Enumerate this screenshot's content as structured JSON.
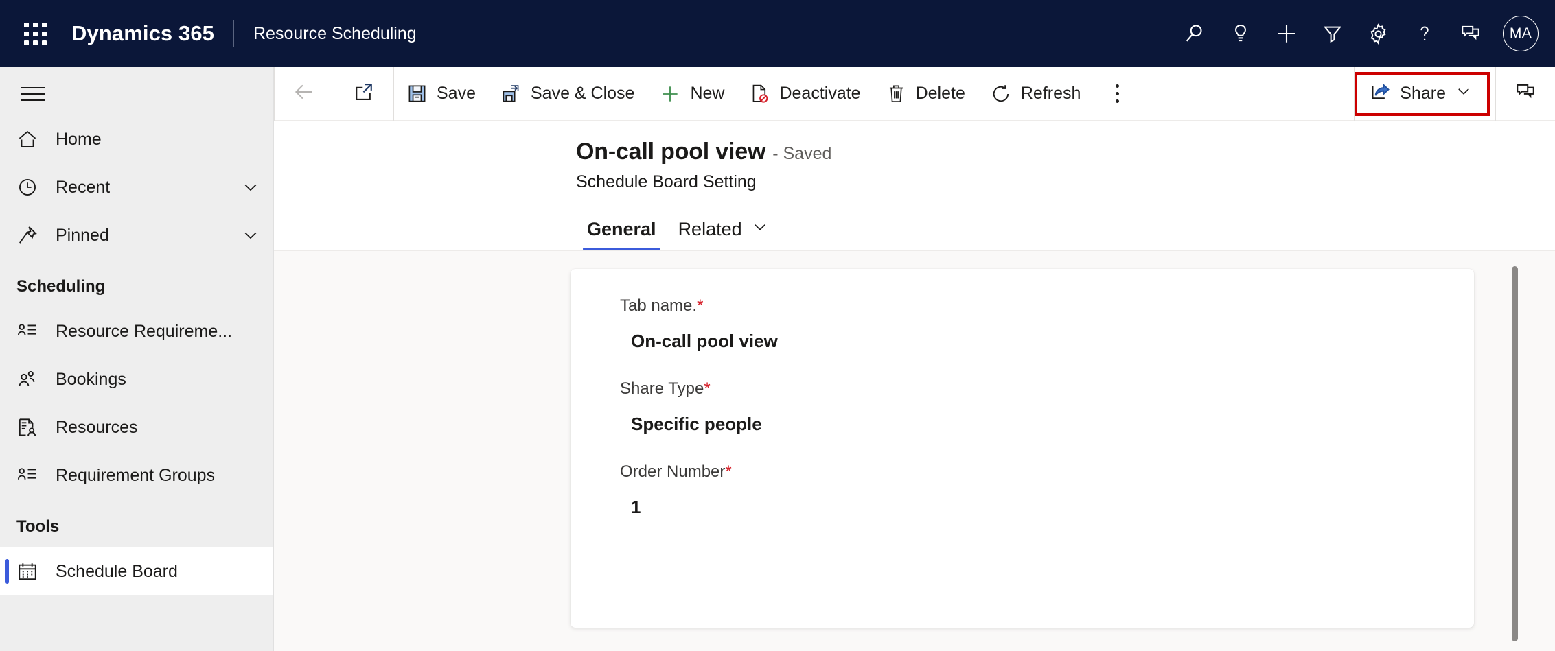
{
  "appbar": {
    "waffle_label": "app-launcher",
    "brand": "Dynamics 365",
    "app_name": "Resource Scheduling",
    "actions": [
      {
        "name": "search-icon",
        "label": "Search"
      },
      {
        "name": "lightbulb-icon",
        "label": "Insights"
      },
      {
        "name": "plus-icon",
        "label": "New"
      },
      {
        "name": "filter-icon",
        "label": "Filter"
      },
      {
        "name": "gear-icon",
        "label": "Settings"
      },
      {
        "name": "help-icon",
        "label": "Help"
      },
      {
        "name": "feedback-icon",
        "label": "Feedback"
      }
    ],
    "avatar_initials": "MA"
  },
  "sidebar": {
    "items": [
      {
        "label": "Home",
        "icon": "home-icon",
        "chevron": false,
        "selected": false
      },
      {
        "label": "Recent",
        "icon": "clock-icon",
        "chevron": true,
        "selected": false
      },
      {
        "label": "Pinned",
        "icon": "pin-icon",
        "chevron": true,
        "selected": false
      }
    ],
    "group_scheduling": "Scheduling",
    "scheduling_items": [
      {
        "label": "Resource Requireme...",
        "icon": "resource-requirements-icon",
        "selected": false
      },
      {
        "label": "Bookings",
        "icon": "bookings-icon",
        "selected": false
      },
      {
        "label": "Resources",
        "icon": "resources-icon",
        "selected": false
      },
      {
        "label": "Requirement Groups",
        "icon": "requirement-groups-icon",
        "selected": false
      }
    ],
    "group_tools": "Tools",
    "tools_items": [
      {
        "label": "Schedule Board",
        "icon": "calendar-icon",
        "selected": true
      }
    ]
  },
  "commandbar": {
    "back_label": "Back",
    "popout_label": "Open in new window",
    "buttons": [
      {
        "label": "Save",
        "icon": "save-icon"
      },
      {
        "label": "Save & Close",
        "icon": "save-close-icon"
      },
      {
        "label": "New",
        "icon": "plus-icon"
      },
      {
        "label": "Deactivate",
        "icon": "deactivate-icon"
      },
      {
        "label": "Delete",
        "icon": "trash-icon"
      },
      {
        "label": "Refresh",
        "icon": "refresh-icon"
      }
    ],
    "overflow_label": "More commands",
    "share_label": "Share",
    "chat_label": "Conversation",
    "highlight_color": "#cc0000"
  },
  "record": {
    "title": "On-call pool view",
    "status": "- Saved",
    "entity": "Schedule Board Setting"
  },
  "tabs": [
    {
      "label": "General",
      "active": true,
      "chevron": false
    },
    {
      "label": "Related",
      "active": false,
      "chevron": true
    }
  ],
  "form": {
    "fields": [
      {
        "label": "Tab name.",
        "required": true,
        "value": "On-call pool view"
      },
      {
        "label": "Share Type",
        "required": true,
        "value": "Specific people"
      },
      {
        "label": "Order Number",
        "required": true,
        "value": "1"
      }
    ]
  },
  "colors": {
    "appbar_bg": "#0b1739",
    "accent": "#3b5bdb",
    "required": "#d6202a",
    "sidebar_bg": "#eeeeee"
  }
}
